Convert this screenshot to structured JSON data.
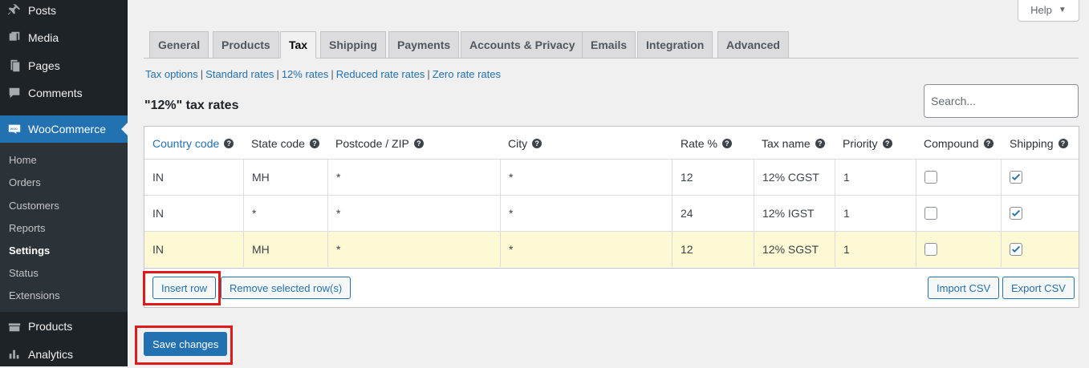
{
  "sidebar": {
    "items": [
      {
        "label": "Posts",
        "icon": "pin-icon"
      },
      {
        "label": "Media",
        "icon": "media-icon"
      },
      {
        "label": "Pages",
        "icon": "pages-icon"
      },
      {
        "label": "Comments",
        "icon": "comments-icon"
      },
      {
        "label": "WooCommerce",
        "icon": "woo-icon"
      }
    ],
    "woo_submenu": [
      "Home",
      "Orders",
      "Customers",
      "Reports",
      "Settings",
      "Status",
      "Extensions"
    ],
    "woo_submenu_current": "Settings",
    "lower_items": [
      {
        "label": "Products",
        "icon": "products-icon"
      },
      {
        "label": "Analytics",
        "icon": "analytics-icon"
      }
    ]
  },
  "help": {
    "label": "Help",
    "caret": "▼"
  },
  "tabs": [
    "General",
    "Products",
    "Tax",
    "Shipping",
    "Payments",
    "Accounts & Privacy",
    "Emails",
    "Integration",
    "Advanced"
  ],
  "active_tab": "Tax",
  "subsections": [
    "Tax options",
    "Standard rates",
    "12% rates",
    "Reduced rate rates",
    "Zero rate rates"
  ],
  "page_title": "\"12%\" tax rates",
  "search": {
    "placeholder": "Search..."
  },
  "table": {
    "headers": [
      "Country code",
      "State code",
      "Postcode / ZIP",
      "City",
      "Rate %",
      "Tax name",
      "Priority",
      "Compound",
      "Shipping"
    ],
    "help_icon": "?",
    "rows": [
      {
        "country": "IN",
        "state": "MH",
        "postcode": "*",
        "city": "*",
        "rate": "12",
        "name": "12% CGST",
        "priority": "1",
        "compound": false,
        "shipping": true
      },
      {
        "country": "IN",
        "state": "*",
        "postcode": "*",
        "city": "*",
        "rate": "24",
        "name": "12% IGST",
        "priority": "1",
        "compound": false,
        "shipping": true
      },
      {
        "country": "IN",
        "state": "MH",
        "postcode": "*",
        "city": "*",
        "rate": "12",
        "name": "12% SGST",
        "priority": "1",
        "compound": false,
        "shipping": true
      }
    ]
  },
  "buttons": {
    "insert_row": "Insert row",
    "remove_rows": "Remove selected row(s)",
    "import_csv": "Import CSV",
    "export_csv": "Export CSV",
    "save_changes": "Save changes"
  },
  "colors": {
    "accent": "#2271b1",
    "sidebar": "#1d2327",
    "highlight": "#e0191b",
    "selected_row": "#fcf9d4"
  }
}
